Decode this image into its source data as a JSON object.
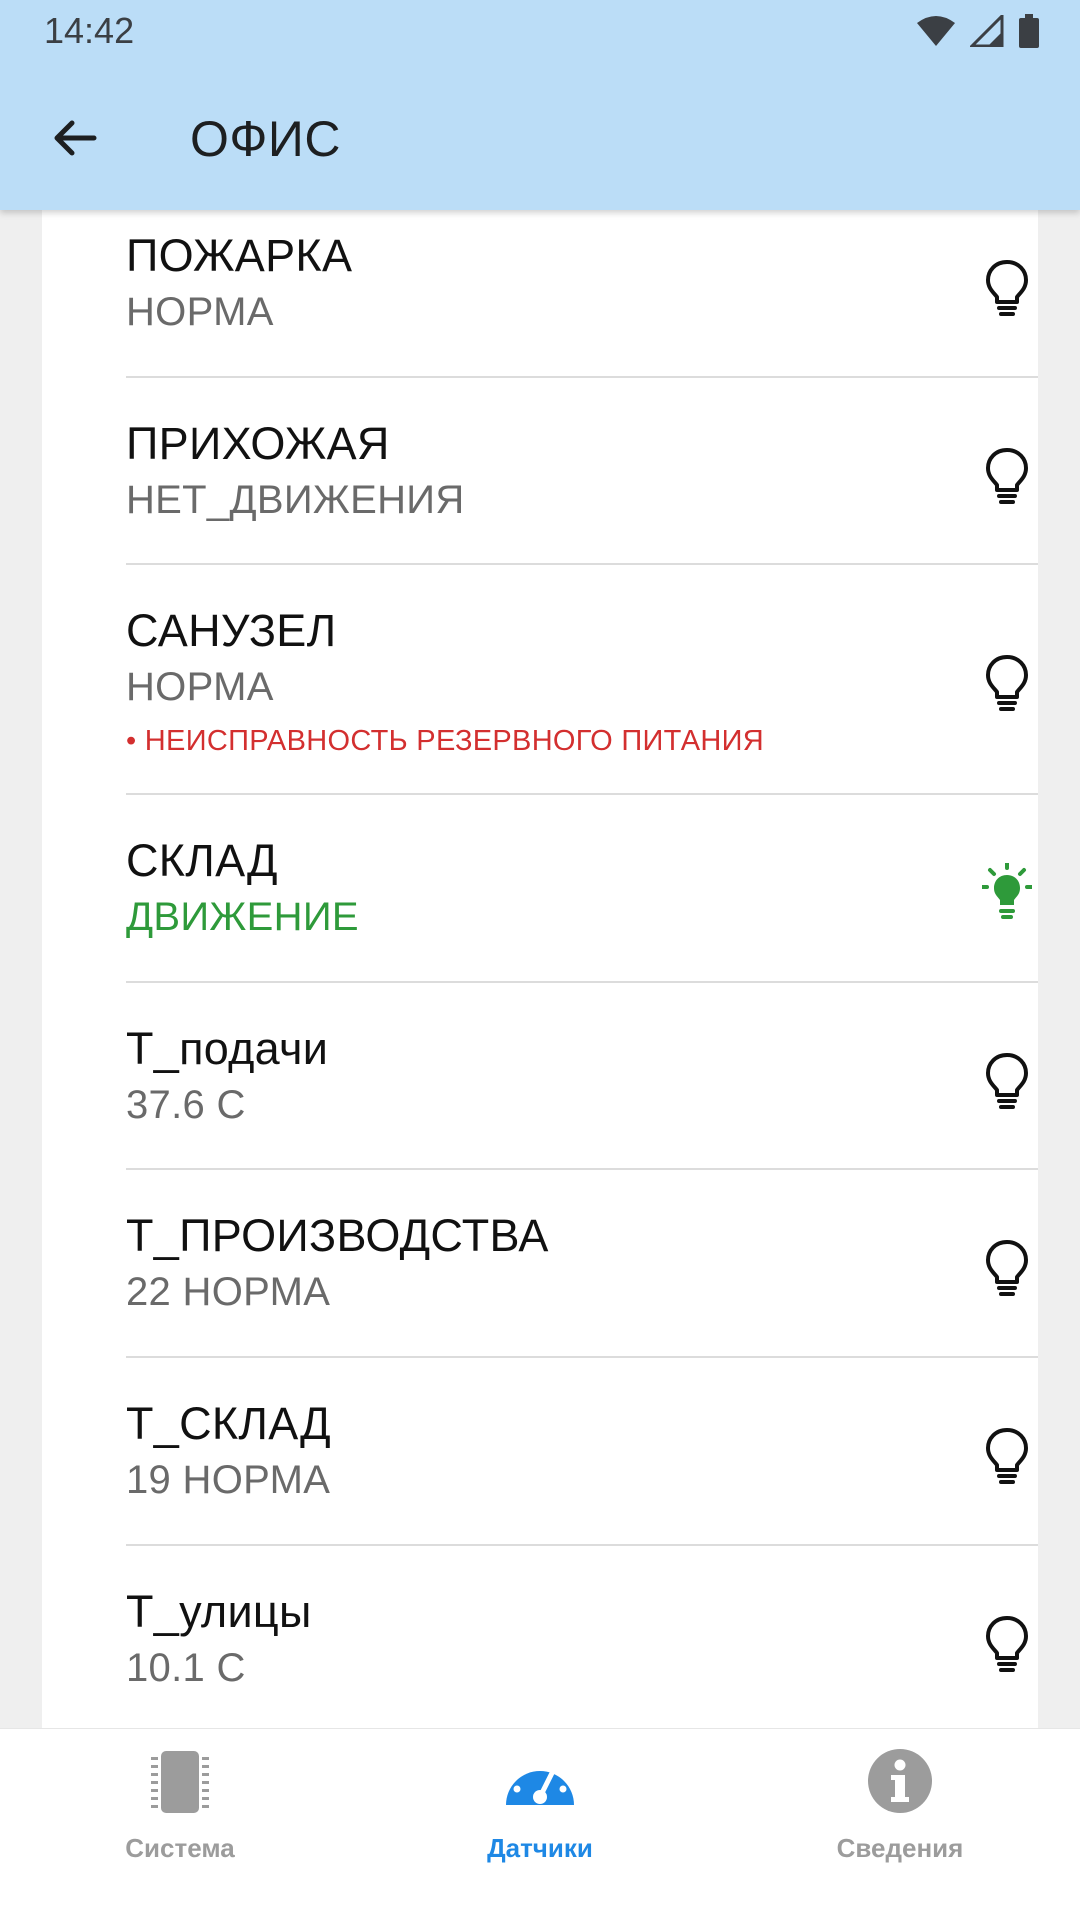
{
  "status_bar": {
    "time": "14:42"
  },
  "header": {
    "title": "ОФИС",
    "back_icon": "arrow-back-icon"
  },
  "sensors": [
    {
      "name": "ПОЖАРКА",
      "state": "НОРМА",
      "fault": "",
      "active": false
    },
    {
      "name": "ПРИХОЖАЯ",
      "state": "НЕТ_ДВИЖЕНИЯ",
      "fault": "",
      "active": false
    },
    {
      "name": "САНУЗЕЛ",
      "state": "НОРМА",
      "fault": "• НЕИСПРАВНОСТЬ РЕЗЕРВНОГО ПИТАНИЯ",
      "active": false
    },
    {
      "name": "СКЛАД",
      "state": "ДВИЖЕНИЕ",
      "fault": "",
      "active": true
    },
    {
      "name": "Т_подачи",
      "state": "37.6 C",
      "fault": "",
      "active": false
    },
    {
      "name": "Т_ПРОИЗВОДСТВА",
      "state": "22 НОРМА",
      "fault": "",
      "active": false
    },
    {
      "name": "Т_СКЛАД",
      "state": "19 НОРМА",
      "fault": "",
      "active": false
    },
    {
      "name": "Т_улицы",
      "state": "10.1 C",
      "fault": "",
      "active": false
    }
  ],
  "bottom_nav": {
    "items": [
      {
        "label": "Система",
        "icon": "chip-icon",
        "active": false
      },
      {
        "label": "Датчики",
        "icon": "gauge-icon",
        "active": true
      },
      {
        "label": "Сведения",
        "icon": "info-icon",
        "active": false
      }
    ]
  },
  "colors": {
    "appbar": "#bbddf7",
    "active_state": "#2e9a3a",
    "fault": "#d32f2f",
    "nav_active": "#1e88e5",
    "nav_inactive": "#9c9c9c"
  }
}
